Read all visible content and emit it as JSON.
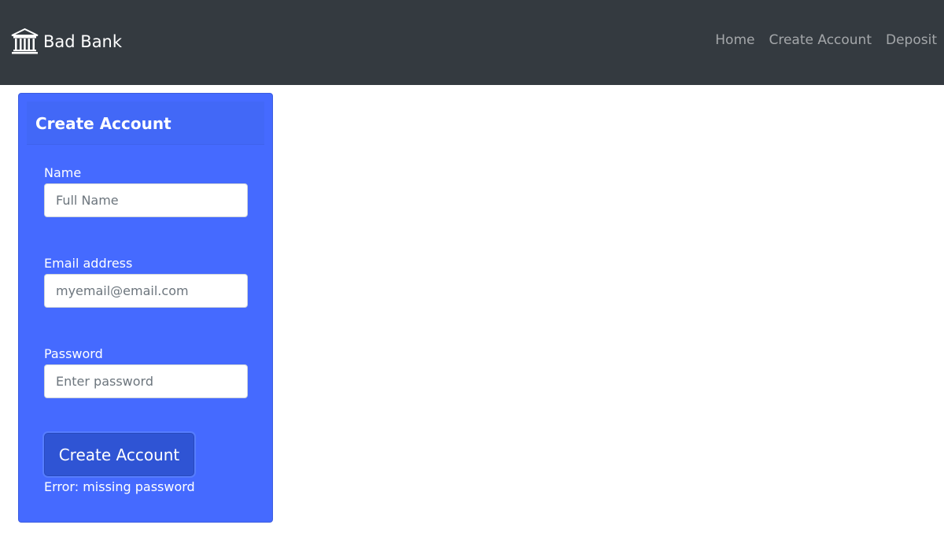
{
  "navbar": {
    "brand_label": "Bad Bank",
    "brand_icon": "bank-icon",
    "links": [
      {
        "label": "Home"
      },
      {
        "label": "Create Account"
      },
      {
        "label": "Deposit"
      }
    ]
  },
  "card": {
    "header": "Create Account",
    "fields": {
      "name": {
        "label": "Name",
        "value": "",
        "placeholder": "Full Name"
      },
      "email": {
        "label": "Email address",
        "value": "",
        "placeholder": "myemail@email.com"
      },
      "password": {
        "label": "Password",
        "value": "",
        "placeholder": "Enter password"
      }
    },
    "submit_label": "Create Account",
    "status": "Error: missing password"
  },
  "colors": {
    "navbar_bg": "#343a40",
    "card_bg": "#456aff",
    "button_bg": "#2f54d4",
    "text_on_card": "#ffffff"
  }
}
